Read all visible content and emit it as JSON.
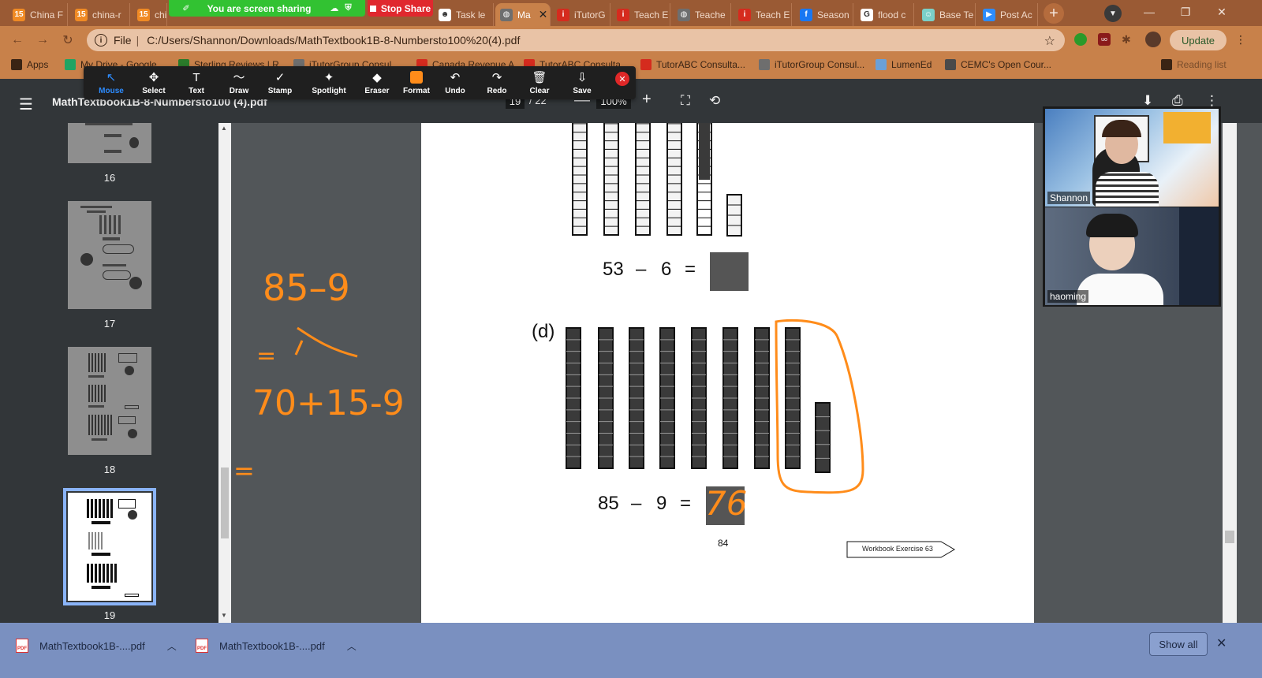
{
  "zoom_share": {
    "sharing_text": "You are screen sharing",
    "stop_share_label": "Stop Share"
  },
  "tabs": [
    {
      "label": "China F",
      "color": "#f08a24",
      "glyph": "15"
    },
    {
      "label": "china-r",
      "color": "#f08a24",
      "glyph": "15"
    },
    {
      "label": "chin",
      "color": "#f08a24",
      "glyph": "15"
    },
    {
      "label": "Task le",
      "color": "#ffffff",
      "glyph": "☻"
    },
    {
      "label": "Ma",
      "color": "#6e6e6e",
      "glyph": "◍",
      "active": true
    },
    {
      "label": "iTutorG",
      "color": "#d52b1e",
      "glyph": "i"
    },
    {
      "label": "Teach E",
      "color": "#d52b1e",
      "glyph": "i"
    },
    {
      "label": "Teache",
      "color": "#6e6e6e",
      "glyph": "◍"
    },
    {
      "label": "Teach E",
      "color": "#d52b1e",
      "glyph": "i"
    },
    {
      "label": "Season",
      "color": "#1877f2",
      "glyph": "f"
    },
    {
      "label": "flood c",
      "color": "#ffffff",
      "glyph": "G"
    },
    {
      "label": "Base Te",
      "color": "#7bd0c8",
      "glyph": "☺"
    },
    {
      "label": "Post Ac",
      "color": "#2d8cff",
      "glyph": "▶"
    }
  ],
  "address": {
    "file_label": "File",
    "url": "C:/Users/Shannon/Downloads/MathTextbook1B-8-Numbersto100%20(4).pdf",
    "update_label": "Update"
  },
  "bookmarks": [
    {
      "label": "Apps",
      "color": "#3a2414"
    },
    {
      "label": "My Drive - Google...",
      "color": "#1fa463"
    },
    {
      "label": "Sterling Reviews | R...",
      "color": "#2a7a2a"
    },
    {
      "label": "iTutorGroup Consul...",
      "color": "#6e6e6e"
    },
    {
      "label": "Canada Revenue A...",
      "color": "#d52b1e"
    },
    {
      "label": "TutorABC Consulta...",
      "color": "#d52b1e"
    },
    {
      "label": "TutorABC Consulta...",
      "color": "#d52b1e"
    },
    {
      "label": "iTutorGroup Consul...",
      "color": "#6e6e6e"
    },
    {
      "label": "LumenEd",
      "color": "#6aa0d8"
    },
    {
      "label": "CEMC's Open Cour...",
      "color": "#4a4a4a"
    },
    {
      "label": "Reading list",
      "color": "#3a2414"
    }
  ],
  "annotate_tools": [
    {
      "label": "Mouse",
      "icon": "cursor-icon",
      "glyph": "↖",
      "selected": true
    },
    {
      "label": "Select",
      "icon": "move-icon",
      "glyph": "✥"
    },
    {
      "label": "Text",
      "icon": "text-icon",
      "glyph": "T"
    },
    {
      "label": "Draw",
      "icon": "draw-icon",
      "glyph": "〜"
    },
    {
      "label": "Stamp",
      "icon": "stamp-icon",
      "glyph": "✓"
    },
    {
      "label": "Spotlight",
      "icon": "spotlight-icon",
      "glyph": "✦"
    },
    {
      "label": "Eraser",
      "icon": "eraser-icon",
      "glyph": "◆"
    },
    {
      "label": "Format",
      "icon": "format-icon",
      "glyph": ""
    },
    {
      "label": "Undo",
      "icon": "undo-icon",
      "glyph": "↶"
    },
    {
      "label": "Redo",
      "icon": "redo-icon",
      "glyph": "↷"
    },
    {
      "label": "Clear",
      "icon": "trash-icon",
      "glyph": "🗑"
    },
    {
      "label": "Save",
      "icon": "save-icon",
      "glyph": "⇩"
    }
  ],
  "pdf": {
    "title": "MathTextbook1B-8-Numbersto100 (4).pdf",
    "page_current": "19",
    "page_total": "/ 22",
    "zoom": "100%"
  },
  "thumbnails": [
    {
      "number": "16"
    },
    {
      "number": "17"
    },
    {
      "number": "18"
    },
    {
      "number": "19",
      "current": true
    }
  ],
  "page_content": {
    "eq_c": {
      "a": "53",
      "op": "–",
      "b": "6",
      "eq": "="
    },
    "label_d": "(d)",
    "eq_d": {
      "a": "85",
      "op": "–",
      "b": "9",
      "eq": "="
    },
    "handwritten_answer": "76",
    "page_number": "84",
    "workbook_tag": "Workbook Exercise 63"
  },
  "handwriting": {
    "line1": "85–9",
    "line3": "70+15-9",
    "eq_sign": "=",
    "eq_sign2": "="
  },
  "participants": [
    {
      "name": "Shannon"
    },
    {
      "name": "haoming"
    }
  ],
  "downloads": [
    {
      "name": "MathTextbook1B-....pdf"
    },
    {
      "name": "MathTextbook1B-....pdf"
    }
  ],
  "download_bar": {
    "show_all": "Show all"
  },
  "colors": {
    "ink": "#ff8c1a",
    "share_green": "#32c232",
    "stop_red": "#e0282e",
    "chrome_theme": "#c8814a"
  }
}
